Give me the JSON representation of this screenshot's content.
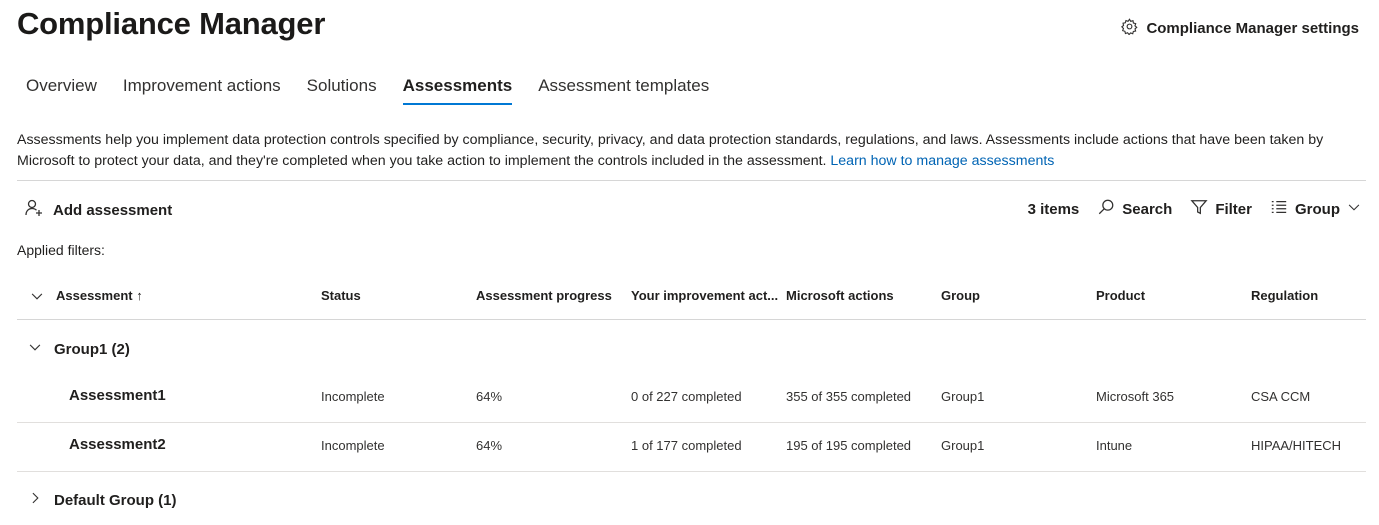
{
  "header": {
    "title": "Compliance Manager",
    "settings_label": "Compliance Manager settings"
  },
  "tabs": [
    {
      "label": "Overview",
      "active": false
    },
    {
      "label": "Improvement actions",
      "active": false
    },
    {
      "label": "Solutions",
      "active": false
    },
    {
      "label": "Assessments",
      "active": true
    },
    {
      "label": "Assessment templates",
      "active": false
    }
  ],
  "description": {
    "text": "Assessments help you implement data protection controls specified by compliance, security, privacy, and data protection standards, regulations, and laws. Assessments include actions that have been taken by Microsoft to protect your data, and they're completed when you take action to implement the controls included in the assessment. ",
    "link": "Learn how to manage assessments"
  },
  "toolbar": {
    "add_label": "Add assessment",
    "count": "3 items",
    "search_label": "Search",
    "filter_label": "Filter",
    "group_label": "Group"
  },
  "applied_filters_label": "Applied filters:",
  "table": {
    "columns": [
      "Assessment",
      "Status",
      "Assessment progress",
      "Your improvement act...",
      "Microsoft actions",
      "Group",
      "Product",
      "Regulation"
    ],
    "sort_indicator": "↑",
    "groups": [
      {
        "label": "Group1 (2)",
        "expanded": true,
        "rows": [
          [
            "Assessment1",
            "Incomplete",
            "64%",
            "0 of 227 completed",
            "355 of 355 completed",
            "Group1",
            "Microsoft 365",
            "CSA CCM"
          ],
          [
            "Assessment2",
            "Incomplete",
            "64%",
            "1 of 177 completed",
            "195 of 195 completed",
            "Group1",
            "Intune",
            "HIPAA/HITECH"
          ]
        ]
      },
      {
        "label": "Default Group (1)",
        "expanded": false,
        "rows": []
      }
    ]
  },
  "colors": {
    "accent": "#0078d4",
    "link": "#0064b4",
    "divider": "#d6d6d6"
  }
}
